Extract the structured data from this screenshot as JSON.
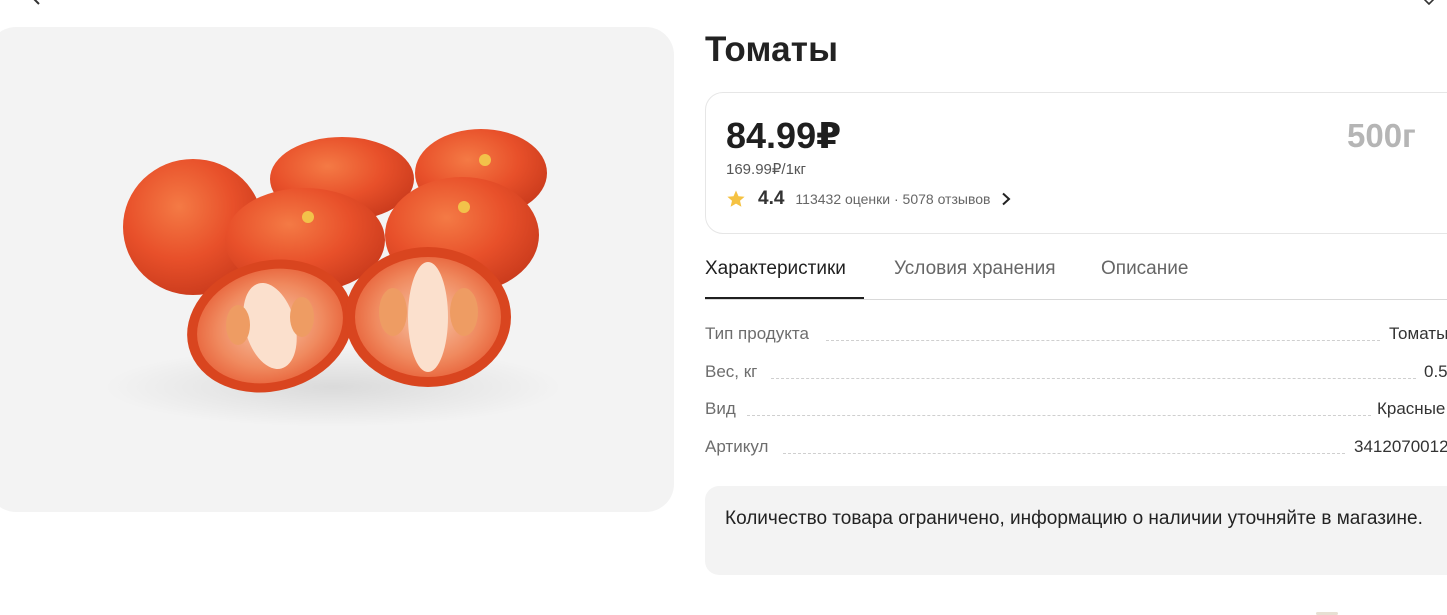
{
  "product": {
    "title": "Томаты",
    "image_alt": "Томаты"
  },
  "price_card": {
    "price": "84.99₽",
    "unit_price": "169.99₽/1кг",
    "weight": "500г",
    "rating": {
      "value": "4.4",
      "summary": "113432 оценки · 5078 отзывов",
      "star_color": "#f5c242"
    }
  },
  "tabs": [
    {
      "label": "Характеристики",
      "active": true
    },
    {
      "label": "Условия хранения",
      "active": false
    },
    {
      "label": "Описание",
      "active": false
    }
  ],
  "specs": [
    {
      "label": "Тип продукта",
      "value": "Томаты"
    },
    {
      "label": "Вес, кг",
      "value": "0.5"
    },
    {
      "label": "Вид",
      "value": "Красные"
    },
    {
      "label": "Артикул",
      "value": "3412070012"
    }
  ],
  "notice": {
    "text": "Количество товара ограничено, информацию о наличии уточняйте в магазине."
  },
  "icons": {
    "back": "back-arrow-icon",
    "favorite": "favorite-icon",
    "star": "star-icon",
    "chevron": "chevron-right-icon"
  },
  "colors": {
    "accent_star": "#f5c242",
    "muted_text": "#b5b5b5",
    "image_bg": "#f3f3f3",
    "notice_bg": "#f3f3f3"
  }
}
